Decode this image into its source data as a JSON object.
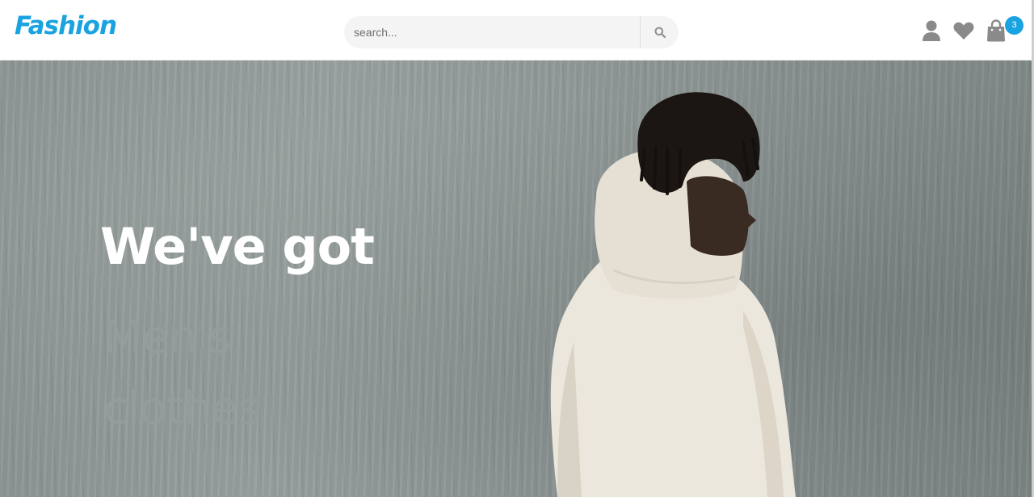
{
  "header": {
    "logo": "Fashion",
    "search": {
      "placeholder": "search..."
    },
    "cart_count": "3"
  },
  "icons": {
    "search": "search-icon",
    "user": "user-icon",
    "wishlist": "heart-icon",
    "cart": "shopping-bag-icon"
  },
  "hero": {
    "headline": "We've got",
    "rotating_text": "Men's clothes"
  },
  "colors": {
    "accent": "#1aa3e0",
    "icon": "#8a8a8a",
    "headline": "#ffffff"
  }
}
